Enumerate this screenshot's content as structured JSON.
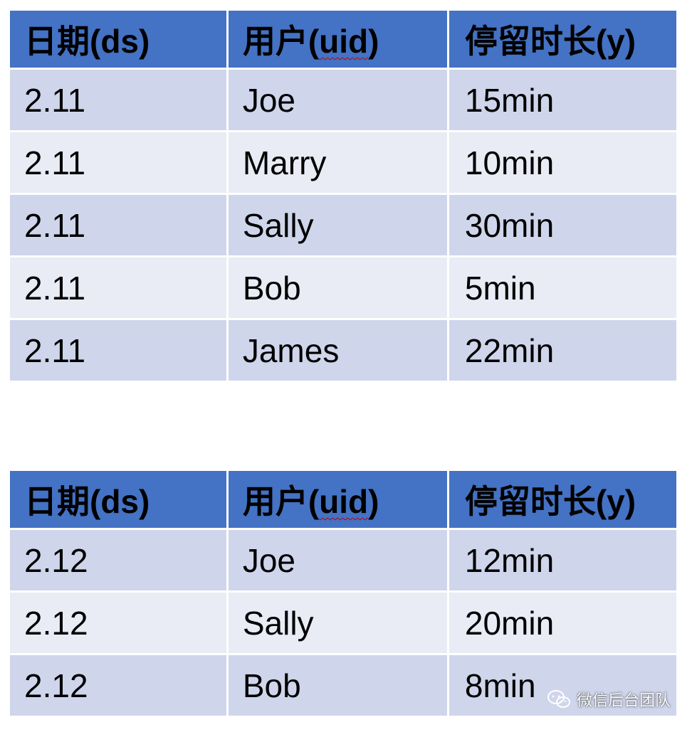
{
  "tables": [
    {
      "headers": {
        "date_prefix": "日期(",
        "date_field": "ds",
        "date_suffix": ")",
        "user_prefix": "用户(",
        "user_field": "uid",
        "user_suffix": ")",
        "stay": "停留时长(y)"
      },
      "rows": [
        {
          "date": "2.11",
          "user": "Joe",
          "stay": "15min"
        },
        {
          "date": "2.11",
          "user": "Marry",
          "stay": "10min"
        },
        {
          "date": "2.11",
          "user": "Sally",
          "stay": "30min"
        },
        {
          "date": "2.11",
          "user": "Bob",
          "stay": "5min"
        },
        {
          "date": "2.11",
          "user": "James",
          "stay": "22min"
        }
      ]
    },
    {
      "headers": {
        "date_prefix": "日期(",
        "date_field": "ds",
        "date_suffix": ")",
        "user_prefix": "用户(",
        "user_field": "uid",
        "user_suffix": ")",
        "stay": "停留时长(y)"
      },
      "rows": [
        {
          "date": "2.12",
          "user": "Joe",
          "stay": "12min"
        },
        {
          "date": "2.12",
          "user": "Sally",
          "stay": "20min"
        },
        {
          "date": "2.12",
          "user": "Bob",
          "stay": "8min"
        }
      ]
    }
  ],
  "watermark": {
    "text": "微信后台团队",
    "icon": "wechat-icon"
  },
  "colors": {
    "header_bg": "#4472c4",
    "row_odd_bg": "#cfd5ea",
    "row_even_bg": "#e9ebf5"
  }
}
